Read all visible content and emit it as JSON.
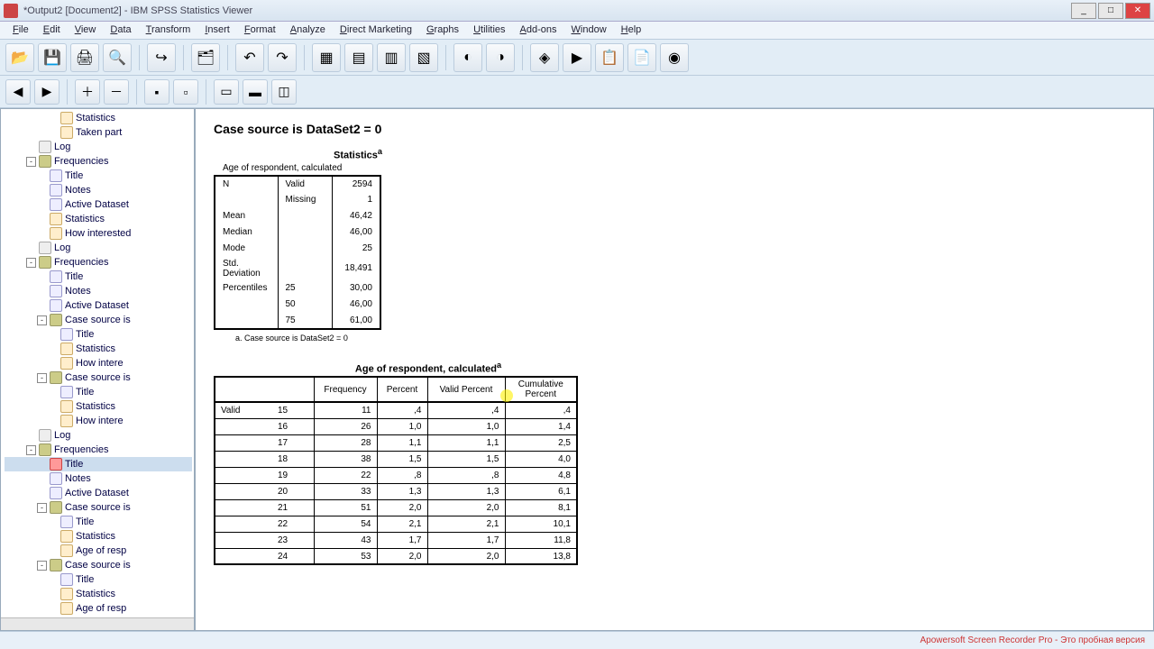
{
  "window": {
    "title": "*Output2 [Document2] - IBM SPSS Statistics Viewer"
  },
  "menu": [
    "File",
    "Edit",
    "View",
    "Data",
    "Transform",
    "Insert",
    "Format",
    "Analyze",
    "Direct Marketing",
    "Graphs",
    "Utilities",
    "Add-ons",
    "Window",
    "Help"
  ],
  "tree": [
    {
      "indent": 4,
      "icon": "tbl",
      "label": "Statistics"
    },
    {
      "indent": 4,
      "icon": "tbl",
      "label": "Taken part"
    },
    {
      "indent": 2,
      "icon": "log",
      "label": "Log"
    },
    {
      "indent": 2,
      "icon": "book",
      "exp": "-",
      "label": "Frequencies"
    },
    {
      "indent": 3,
      "icon": "page",
      "label": "Title"
    },
    {
      "indent": 3,
      "icon": "page",
      "label": "Notes"
    },
    {
      "indent": 3,
      "icon": "page",
      "label": "Active Dataset"
    },
    {
      "indent": 3,
      "icon": "tbl",
      "label": "Statistics"
    },
    {
      "indent": 3,
      "icon": "tbl",
      "label": "How interested"
    },
    {
      "indent": 2,
      "icon": "log",
      "label": "Log"
    },
    {
      "indent": 2,
      "icon": "book",
      "exp": "-",
      "label": "Frequencies"
    },
    {
      "indent": 3,
      "icon": "page",
      "label": "Title"
    },
    {
      "indent": 3,
      "icon": "page",
      "label": "Notes"
    },
    {
      "indent": 3,
      "icon": "page",
      "label": "Active Dataset"
    },
    {
      "indent": 3,
      "icon": "book",
      "exp": "-",
      "label": "Case source is"
    },
    {
      "indent": 4,
      "icon": "page",
      "label": "Title"
    },
    {
      "indent": 4,
      "icon": "tbl",
      "label": "Statistics"
    },
    {
      "indent": 4,
      "icon": "tbl",
      "label": "How intere"
    },
    {
      "indent": 3,
      "icon": "book",
      "exp": "-",
      "label": "Case source is"
    },
    {
      "indent": 4,
      "icon": "page",
      "label": "Title"
    },
    {
      "indent": 4,
      "icon": "tbl",
      "label": "Statistics"
    },
    {
      "indent": 4,
      "icon": "tbl",
      "label": "How intere"
    },
    {
      "indent": 2,
      "icon": "log",
      "label": "Log"
    },
    {
      "indent": 2,
      "icon": "book",
      "exp": "-",
      "label": "Frequencies"
    },
    {
      "indent": 3,
      "icon": "red",
      "label": "Title",
      "active": true
    },
    {
      "indent": 3,
      "icon": "page",
      "label": "Notes"
    },
    {
      "indent": 3,
      "icon": "page",
      "label": "Active Dataset"
    },
    {
      "indent": 3,
      "icon": "book",
      "exp": "-",
      "label": "Case source is"
    },
    {
      "indent": 4,
      "icon": "page",
      "label": "Title"
    },
    {
      "indent": 4,
      "icon": "tbl",
      "label": "Statistics"
    },
    {
      "indent": 4,
      "icon": "tbl",
      "label": "Age of resp"
    },
    {
      "indent": 3,
      "icon": "book",
      "exp": "-",
      "label": "Case source is"
    },
    {
      "indent": 4,
      "icon": "page",
      "label": "Title"
    },
    {
      "indent": 4,
      "icon": "tbl",
      "label": "Statistics"
    },
    {
      "indent": 4,
      "icon": "tbl",
      "label": "Age of resp"
    }
  ],
  "content": {
    "heading": "Case source is DataSet2 = 0",
    "stats_title": "Statistics",
    "stats_sup": "a",
    "stats_sub": "Age of respondent, calculated",
    "stats_rows": [
      [
        "N",
        "Valid",
        "2594"
      ],
      [
        "",
        "Missing",
        "1"
      ],
      [
        "Mean",
        "",
        "46,42"
      ],
      [
        "Median",
        "",
        "46,00"
      ],
      [
        "Mode",
        "",
        "25"
      ],
      [
        "Std. Deviation",
        "",
        "18,491"
      ],
      [
        "Percentiles",
        "25",
        "30,00"
      ],
      [
        "",
        "50",
        "46,00"
      ],
      [
        "",
        "75",
        "61,00"
      ]
    ],
    "stats_footer": "a. Case source is DataSet2 = 0",
    "freq_title": "Age of respondent, calculated",
    "freq_sup": "a",
    "freq_headers": [
      "",
      "",
      "Frequency",
      "Percent",
      "Valid Percent",
      "Cumulative Percent"
    ],
    "freq_rows": [
      [
        "Valid",
        "15",
        "11",
        ",4",
        ",4",
        ",4"
      ],
      [
        "",
        "16",
        "26",
        "1,0",
        "1,0",
        "1,4"
      ],
      [
        "",
        "17",
        "28",
        "1,1",
        "1,1",
        "2,5"
      ],
      [
        "",
        "18",
        "38",
        "1,5",
        "1,5",
        "4,0"
      ],
      [
        "",
        "19",
        "22",
        ",8",
        ",8",
        "4,8"
      ],
      [
        "",
        "20",
        "33",
        "1,3",
        "1,3",
        "6,1"
      ],
      [
        "",
        "21",
        "51",
        "2,0",
        "2,0",
        "8,1"
      ],
      [
        "",
        "22",
        "54",
        "2,1",
        "2,1",
        "10,1"
      ],
      [
        "",
        "23",
        "43",
        "1,7",
        "1,7",
        "11,8"
      ],
      [
        "",
        "24",
        "53",
        "2,0",
        "2,0",
        "13,8"
      ]
    ]
  },
  "status": {
    "watermark": "Apowersoft Screen Recorder Pro - Это пробная версия"
  },
  "chart_data": {
    "type": "table",
    "title": "Age of respondent, calculated — Frequencies (DataSet2 = 0)",
    "statistics": {
      "N_valid": 2594,
      "N_missing": 1,
      "Mean": 46.42,
      "Median": 46.0,
      "Mode": 25,
      "Std_Deviation": 18.491,
      "Percentile_25": 30.0,
      "Percentile_50": 46.0,
      "Percentile_75": 61.0
    },
    "frequency_table": {
      "columns": [
        "Age",
        "Frequency",
        "Percent",
        "Valid Percent",
        "Cumulative Percent"
      ],
      "rows": [
        [
          15,
          11,
          0.4,
          0.4,
          0.4
        ],
        [
          16,
          26,
          1.0,
          1.0,
          1.4
        ],
        [
          17,
          28,
          1.1,
          1.1,
          2.5
        ],
        [
          18,
          38,
          1.5,
          1.5,
          4.0
        ],
        [
          19,
          22,
          0.8,
          0.8,
          4.8
        ],
        [
          20,
          33,
          1.3,
          1.3,
          6.1
        ],
        [
          21,
          51,
          2.0,
          2.0,
          8.1
        ],
        [
          22,
          54,
          2.1,
          2.1,
          10.1
        ],
        [
          23,
          43,
          1.7,
          1.7,
          11.8
        ],
        [
          24,
          53,
          2.0,
          2.0,
          13.8
        ]
      ]
    }
  }
}
